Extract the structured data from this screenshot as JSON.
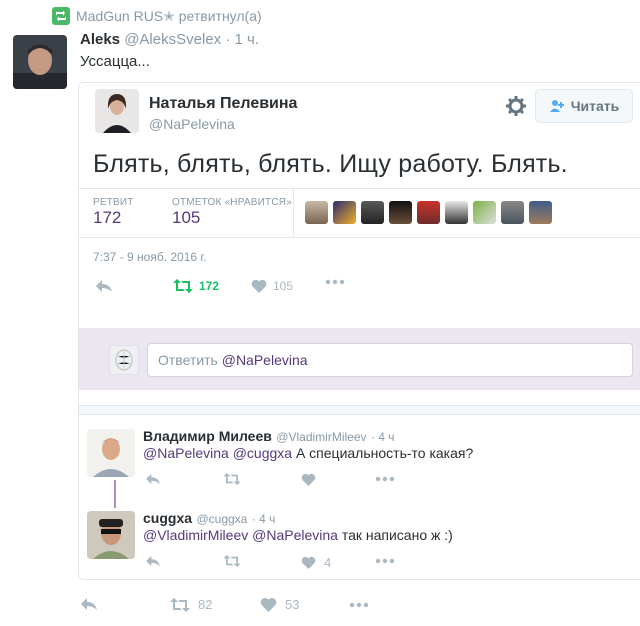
{
  "retweet": {
    "text": "MadGun RUS✭ ретвитнул(а)"
  },
  "tweet": {
    "name": "Aleks",
    "username": "@AleksSvelex",
    "time": "· 1 ч.",
    "text": "Уссацца..."
  },
  "quoted": {
    "name": "Наталья Пелевина",
    "username": "@NaPelevina",
    "follow_label": "Читать",
    "text": "Блять, блять, блять. Ищу работу. Блять.",
    "retweets_label": "РЕТВИТ",
    "retweets": "172",
    "likes_label": "ОТМЕТОК «НРАВИТСЯ»",
    "likes": "105",
    "date": "7:37 - 9 нояб. 2016 г.",
    "actions": {
      "retweets": "172",
      "likes": "105"
    }
  },
  "reply_box": {
    "prefix": "Ответить",
    "mention": "@NaPelevina"
  },
  "replies": [
    {
      "name": "Владимир Милеев",
      "username": "@VladimirMileev",
      "time": "· 4 ч",
      "mention1": "@NaPelevina",
      "mention2": "@cuggxa",
      "text": "А специальность-то какая?",
      "likes": ""
    },
    {
      "name": "cuggxa",
      "username": "@cuggxa",
      "time": "· 4 ч",
      "mention1": "@VladimirMileev",
      "mention2": "@NaPelevina",
      "text": "так написано ж :)",
      "likes": "4"
    }
  ],
  "bottom_actions": {
    "retweets": "82",
    "likes": "53"
  },
  "colors": {
    "accent": "#55397d",
    "muted": "#8899a6",
    "retweet_green": "#17bf63"
  }
}
